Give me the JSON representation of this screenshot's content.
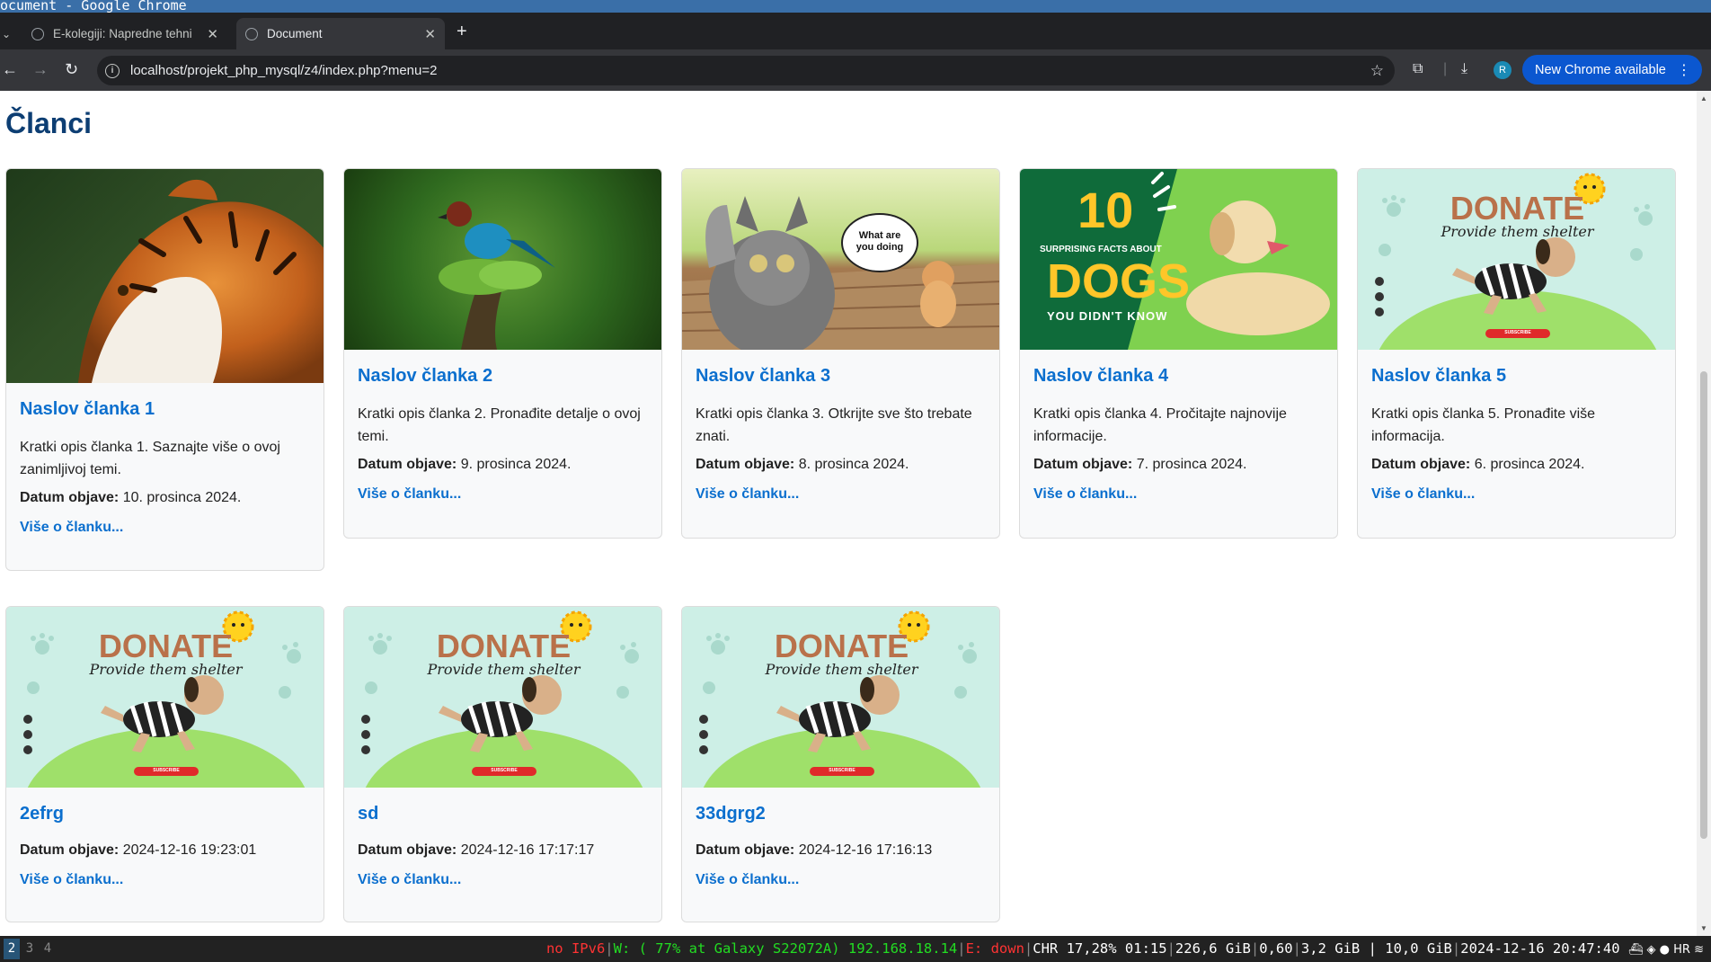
{
  "window": {
    "title": "Document - Google Chrome",
    "title_visible": "ocument - Google Chrome"
  },
  "tabs": [
    {
      "label": "E-kolegiji: Napredne tehni",
      "active": false
    },
    {
      "label": "Document",
      "active": true
    }
  ],
  "address_bar": {
    "url": "localhost/projekt_php_mysql/z4/index.php?menu=2"
  },
  "toolbar": {
    "profile_initial": "R",
    "update_label": "New Chrome available"
  },
  "page": {
    "heading": "Članci",
    "date_label": "Datum objave:",
    "more_label": "Više o članku...",
    "cards": [
      {
        "title": "Naslov članka 1",
        "desc": "Kratki opis članka 1. Saznajte više o ovoj zanimljivoj temi.",
        "date": "10. prosinca 2024.",
        "image": "tiger"
      },
      {
        "title": "Naslov članka 2",
        "desc": "Kratki opis članka 2. Pronađite detalje o ovoj temi.",
        "date": "9. prosinca 2024.",
        "image": "bird"
      },
      {
        "title": "Naslov članka 3",
        "desc": "Kratki opis članka 3. Otkrijte sve što trebate znati.",
        "date": "8. prosinca 2024.",
        "image": "cats"
      },
      {
        "title": "Naslov članka 4",
        "desc": "Kratki opis članka 4. Pročitajte najnovije informacije.",
        "date": "7. prosinca 2024.",
        "image": "dogs"
      },
      {
        "title": "Naslov članka 5",
        "desc": "Kratki opis članka 5. Pronađite više informacija.",
        "date": "6. prosinca 2024.",
        "image": "donate"
      },
      {
        "title": "2efrg",
        "desc": "",
        "date": "2024-12-16 19:23:01",
        "image": "donate"
      },
      {
        "title": "sd",
        "desc": "",
        "date": "2024-12-16 17:17:17",
        "image": "donate"
      },
      {
        "title": "33dgrg2",
        "desc": "",
        "date": "2024-12-16 17:16:13",
        "image": "donate"
      }
    ]
  },
  "image_text": {
    "cats_bubble_1": "What are",
    "cats_bubble_2": "you doing",
    "dogs_number": "10",
    "dogs_line1": "SURPRISING FACTS ABOUT",
    "dogs_word": "DOGS",
    "dogs_line2": "YOU DIDN'T KNOW",
    "donate_word": "DONATE",
    "donate_sub": "Provide them shelter",
    "donate_btn": "SUBSCRIBE"
  },
  "statusbar": {
    "workspaces": [
      "2",
      "3",
      "4"
    ],
    "ipv6": "no IPv6",
    "wifi": "W: ( 77% at Galaxy S22072A) 192.168.18.14",
    "ethernet": "E: down",
    "cpu": "CHR 17,28% 01:15",
    "disk": "226,6 GiB",
    "load": "0,60",
    "mem": "3,2 GiB | 10,0 GiB",
    "datetime": "2024-12-16 20:47:40",
    "lang": "HR"
  }
}
